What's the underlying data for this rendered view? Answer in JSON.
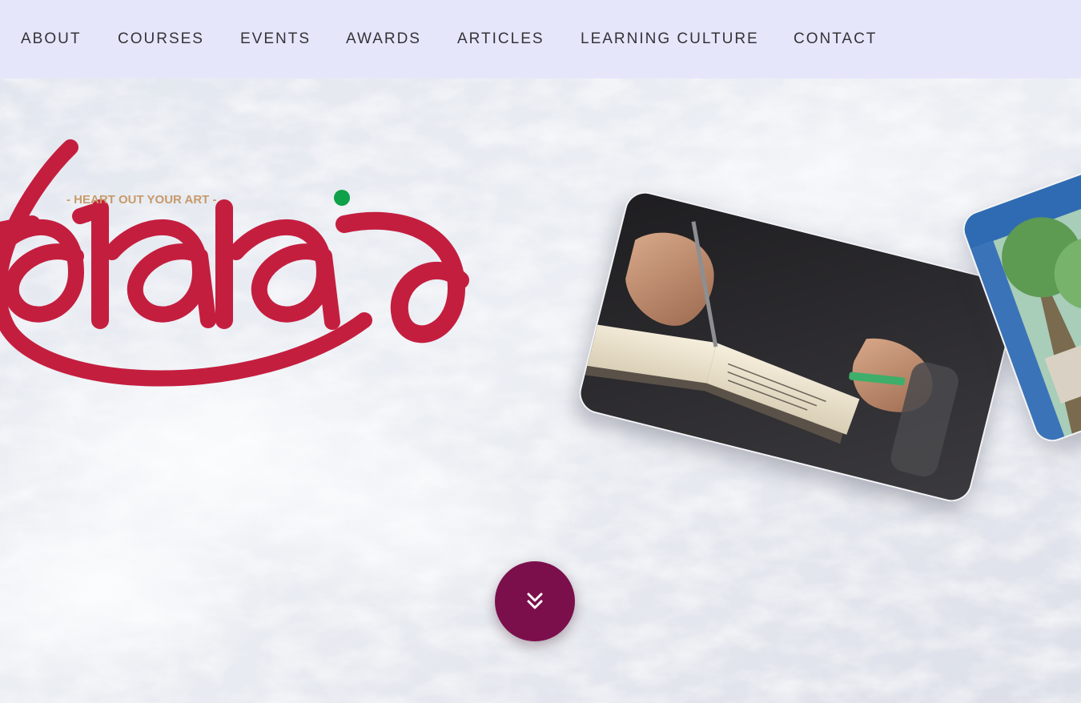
{
  "nav": {
    "items": [
      {
        "label": "ABOUT"
      },
      {
        "label": "COURSES"
      },
      {
        "label": "EVENTS"
      },
      {
        "label": "AWARDS"
      },
      {
        "label": "ARTICLES"
      },
      {
        "label": "LEARNING CULTURE"
      },
      {
        "label": "CONTACT"
      }
    ]
  },
  "hero": {
    "tagline": "- HEART OUT YOUR ART -",
    "logo_text": "Kalalaya",
    "scroll_icon": "double-chevron-down-icon"
  },
  "colors": {
    "nav_bg": "#e6e6fb",
    "brand_red": "#c41e3f",
    "brand_green": "#0fa04a",
    "tagline": "#c89a6a",
    "scroll_button": "#7b0f4c"
  }
}
